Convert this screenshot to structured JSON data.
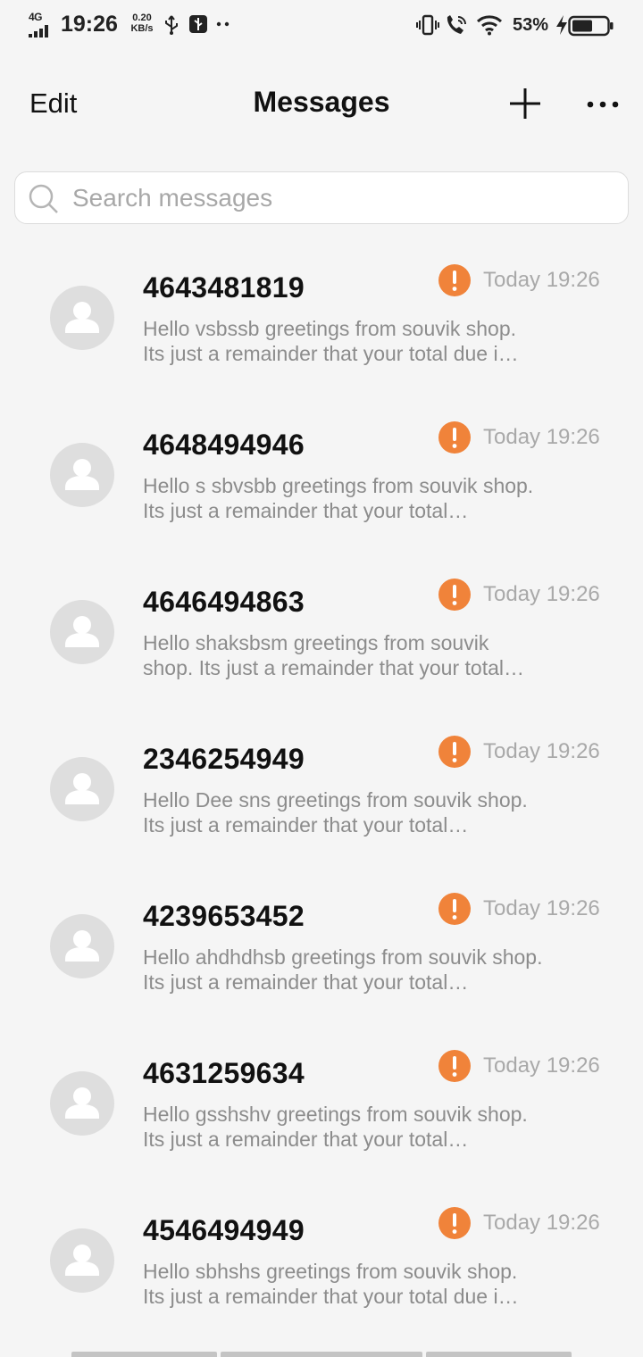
{
  "status_bar": {
    "network": "4G",
    "time": "19:26",
    "speed_value": "0.20",
    "speed_unit": "KB/s",
    "battery_percent": "53%",
    "icons": [
      "signal-bars-icon",
      "usb-icon",
      "usb-debug-icon",
      "more-notifications-icon",
      "vibrate-icon",
      "wifi-calling-icon",
      "wifi-icon",
      "charging-bolt-icon",
      "battery-icon"
    ]
  },
  "header": {
    "edit_label": "Edit",
    "title": "Messages",
    "icons": [
      "plus-icon",
      "more-icon"
    ]
  },
  "search": {
    "placeholder": "Search messages",
    "value": ""
  },
  "colors": {
    "accent_alert": "#f0833a",
    "background": "#f5f5f5",
    "avatar_bg": "#dedede"
  },
  "messages": [
    {
      "sender": "4643481819",
      "time": "Today 19:26",
      "preview": "Hello vsbssb greetings from souvik shop. Its just a remainder that your total due i…",
      "status_icon": "alert-icon"
    },
    {
      "sender": "4648494946",
      "time": "Today 19:26",
      "preview": "Hello s sbvsbb greetings from souvik shop. Its just a remainder that your total…",
      "status_icon": "alert-icon"
    },
    {
      "sender": "4646494863",
      "time": "Today 19:26",
      "preview": "Hello shaksbsm greetings from souvik shop. Its just a remainder that your total…",
      "status_icon": "alert-icon"
    },
    {
      "sender": "2346254949",
      "time": "Today 19:26",
      "preview": "Hello Dee sns greetings from souvik shop. Its just a remainder that your total…",
      "status_icon": "alert-icon"
    },
    {
      "sender": "4239653452",
      "time": "Today 19:26",
      "preview": "Hello ahdhdhsb greetings from souvik shop. Its just a remainder that your total…",
      "status_icon": "alert-icon"
    },
    {
      "sender": "4631259634",
      "time": "Today 19:26",
      "preview": "Hello gsshshv greetings from souvik shop. Its just a remainder that your total…",
      "status_icon": "alert-icon"
    },
    {
      "sender": "4546494949",
      "time": "Today 19:26",
      "preview": "Hello sbhshs greetings from souvik shop. Its just a remainder that your total due i…",
      "status_icon": "alert-icon"
    }
  ]
}
